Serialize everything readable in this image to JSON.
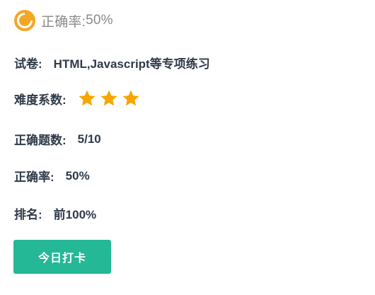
{
  "header": {
    "label": "正确率:",
    "value": "50%",
    "icon": "pie-chart-icon",
    "icon_color": "#f5a623"
  },
  "exam": {
    "label": "试卷:",
    "value": "HTML,Javascript等专项练习"
  },
  "difficulty": {
    "label": "难度系数:",
    "stars": 3,
    "icon": "star-icon",
    "star_color": "#f7a600"
  },
  "correct_count": {
    "label": "正确题数:",
    "value": "5/10"
  },
  "accuracy": {
    "label": "正确率:",
    "value": "50%"
  },
  "rank": {
    "label": "排名:",
    "value": "前100%"
  },
  "checkin": {
    "label": "今日打卡",
    "color": "#24b896"
  }
}
